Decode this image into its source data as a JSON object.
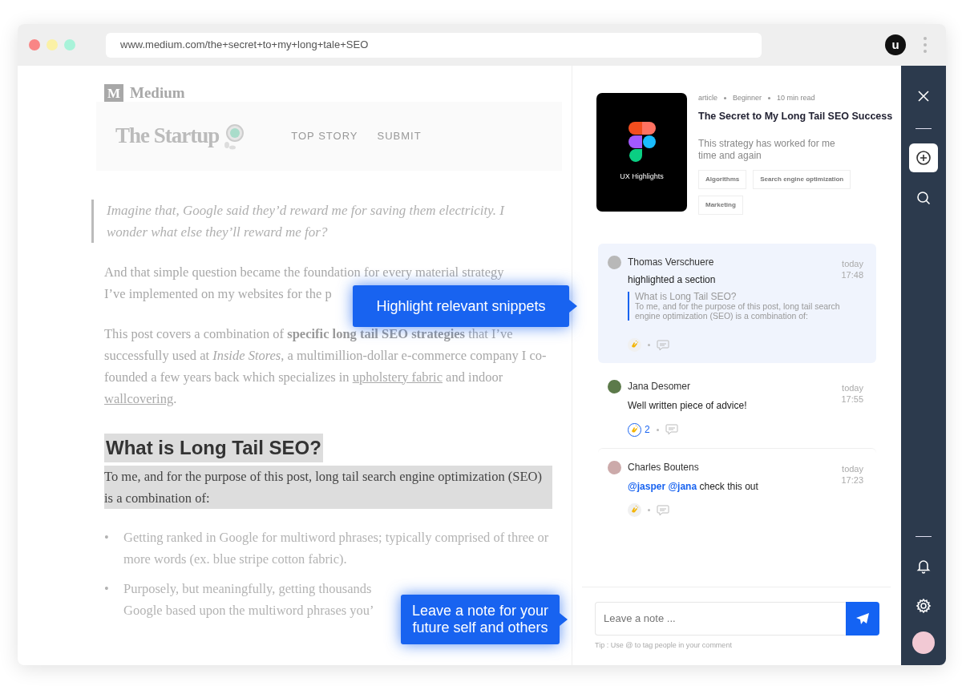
{
  "browser": {
    "url": "www.medium.com/the+secret+to+my+long+tale+SEO",
    "profile_initial": "u"
  },
  "article": {
    "publication": "Medium",
    "publication_mark": "M",
    "brand": "The Startup",
    "nav": [
      "TOP STORY",
      "SUBMIT"
    ],
    "quote": "Imagine that, Google said they’d reward me for saving them electricity. I wonder what else they’ll reward me for?",
    "intro_lines": [
      "And that simple question became the foundation for every material strategy",
      "I’ve implemented on my websites for the p"
    ],
    "paragraphs": [
      [
        {
          "kind": "plain",
          "text": "This post covers a combination of "
        },
        {
          "kind": "bold",
          "text": "specific long tail SEO strategies"
        },
        {
          "kind": "plain",
          "text": " that I’ve successfully used at "
        },
        {
          "kind": "italic",
          "text": "Inside Stores"
        },
        {
          "kind": "plain",
          "text": ", a multimillion-dollar e-commerce company I co-founded a few years back which specializes in "
        },
        {
          "kind": "link",
          "text": "upholstery fabric"
        },
        {
          "kind": "plain",
          "text": " and indoor "
        },
        {
          "kind": "link",
          "text": "wallcovering"
        },
        {
          "kind": "plain",
          "text": "."
        }
      ]
    ],
    "highlight_heading": "What is Long Tail SEO?",
    "highlight_text": "To me, and for the purpose of this post, long tail search engine optimization (SEO) is a combination of:",
    "bullets": [
      {
        "marker": "•",
        "lines": [
          "Getting ranked in Google for multiword phrases; typically comprised of three or more words (ex. blue stripe cotton fabric)."
        ]
      },
      {
        "marker": "•",
        "lines": [
          "Purposely, but meaningfully, getting thousands",
          "Google based upon the multiword phrases you’"
        ]
      }
    ]
  },
  "callouts": [
    {
      "text": "Highlight relevant snippets"
    },
    {
      "text": "Leave a note for your future self and others"
    }
  ],
  "card": {
    "cover_label": "UX Highlights",
    "type": "article",
    "level": "Beginner",
    "read_time": "10 min read",
    "title": "The Secret to My Long Tail SEO Success",
    "subtitle": "This strategy has worked for me time and again",
    "tags": [
      "Algorithms",
      "Search engine optimization",
      "Marketing"
    ]
  },
  "comments": [
    {
      "author": "Thomas Verschuere",
      "selected": true,
      "action": "highlighted a section",
      "quote_title": "What is Long Tail SEO?",
      "quote_text": "To me, and for the purpose of this post, long tail search engine optimization (SEO) is a combination of:",
      "day": "today",
      "time": "17:48",
      "clapped": false
    },
    {
      "author": "Jana Desomer",
      "selected": false,
      "text": "Well written piece of advice!",
      "day": "today",
      "time": "17:55",
      "clapped": true,
      "claps": "2"
    },
    {
      "author": "Charles Boutens",
      "selected": false,
      "mentions": [
        "@jasper",
        "@jana"
      ],
      "text": "check this out",
      "day": "today",
      "time": "17:23",
      "clapped": false
    }
  ],
  "note": {
    "placeholder": "Leave a note ...",
    "tip": "Tip : Use @ to tag people in your comment"
  },
  "rail": {
    "top": [
      {
        "kind": "close",
        "selected": false
      },
      {
        "kind": "add",
        "selected": true
      },
      {
        "kind": "search",
        "selected": false
      }
    ],
    "bottom": [
      {
        "kind": "bell",
        "selected": false
      },
      {
        "kind": "gear",
        "selected": false
      },
      {
        "kind": "avatar",
        "selected": false
      }
    ]
  }
}
